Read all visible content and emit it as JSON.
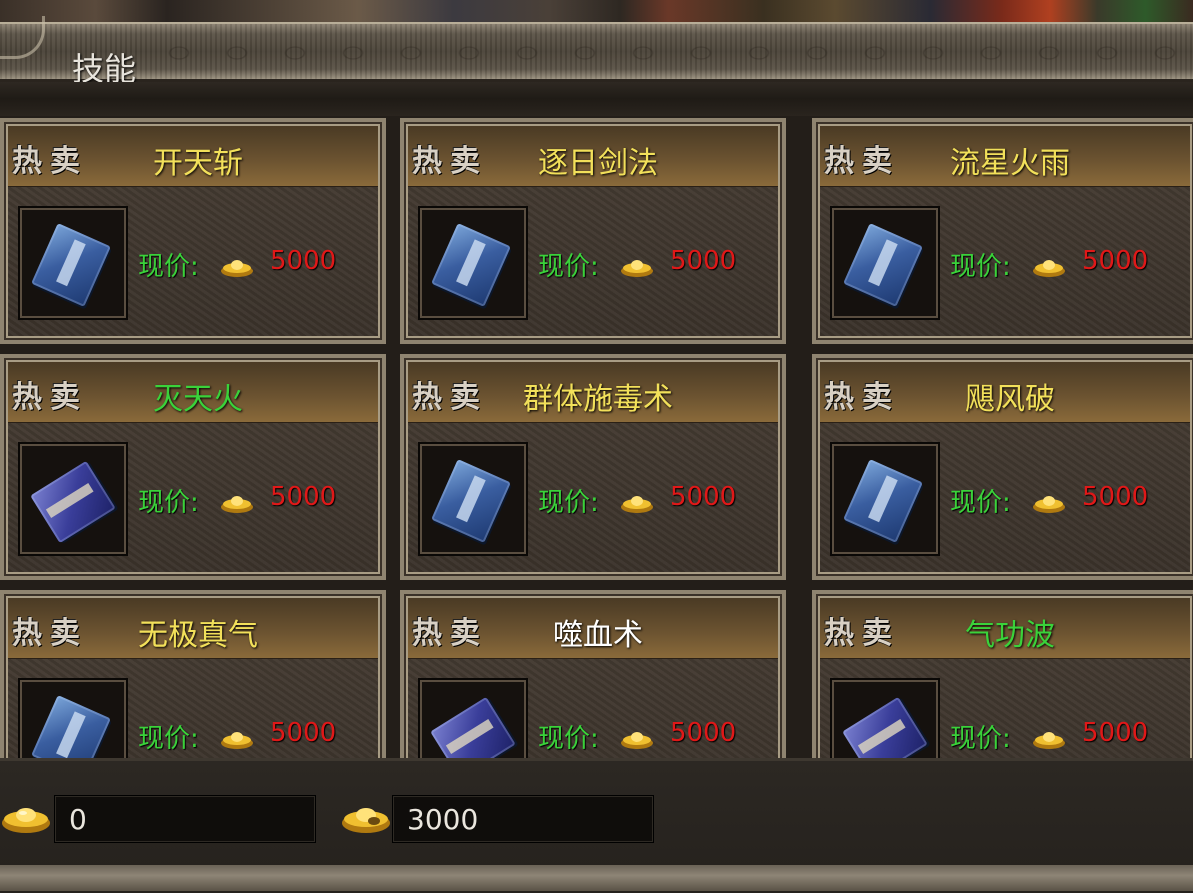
{
  "header": {
    "title": "技能"
  },
  "shop": {
    "hot_label": "热卖",
    "price_label": "现价:",
    "items": [
      {
        "name": "开天斩",
        "name_color": "#f2e05a",
        "price": "5000",
        "book": "blue"
      },
      {
        "name": "逐日剑法",
        "name_color": "#f2e05a",
        "price": "5000",
        "book": "blue"
      },
      {
        "name": "流星火雨",
        "name_color": "#f2e05a",
        "price": "5000",
        "book": "blue"
      },
      {
        "name": "灭天火",
        "name_color": "#3ad23a",
        "price": "5000",
        "book": "violet"
      },
      {
        "name": "群体施毒术",
        "name_color": "#f2e05a",
        "price": "5000",
        "book": "blue"
      },
      {
        "name": "飓风破",
        "name_color": "#f2e05a",
        "price": "5000",
        "book": "blue"
      },
      {
        "name": "无极真气",
        "name_color": "#f2e05a",
        "price": "5000",
        "book": "blue"
      },
      {
        "name": "噬血术",
        "name_color": "#ffffff",
        "price": "5000",
        "book": "violet"
      },
      {
        "name": "气功波",
        "name_color": "#3ad23a",
        "price": "5000",
        "book": "violet"
      }
    ]
  },
  "currency": {
    "gold_ingot": "0",
    "bound_ingot": "3000"
  },
  "colors": {
    "price_label": "#3ad23a",
    "price_value": "#e01818"
  },
  "icons": {
    "item_icon": "skill-book-icon",
    "currency_icon": "gold-ingot-icon"
  }
}
